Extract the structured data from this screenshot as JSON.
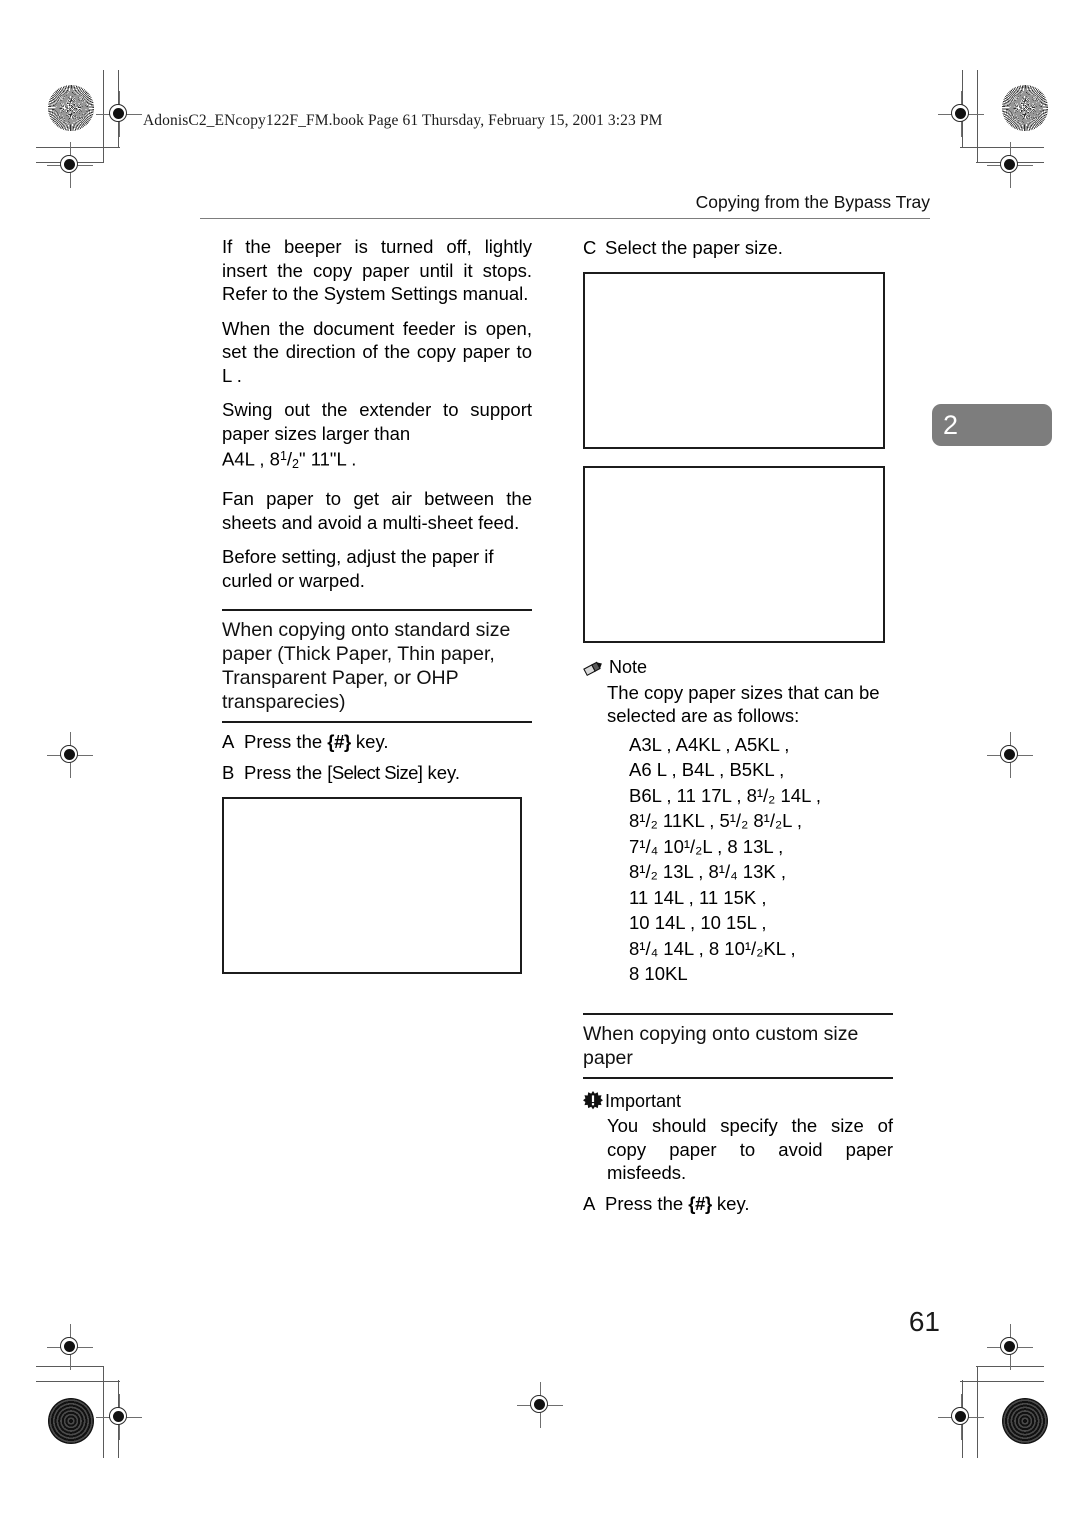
{
  "page": {
    "slugline": "AdonisC2_ENcopy122F_FM.book  Page 61  Thursday, February 15, 2001  3:23 PM",
    "running_header": "Copying from the Bypass Tray",
    "chapter_tab": "2",
    "folio": "61",
    "accent_gray": "#7d7d7d",
    "rule_black": "#1a1a1a"
  },
  "left_column": {
    "paragraphs": [
      "If the beeper is turned off, lightly insert the copy paper until it stops. Refer to the System Settings manual.",
      "When the document feeder is open, set the direction of the copy paper to L .",
      "Swing out the extender to support paper sizes larger than",
      "Fan paper to get air between the sheets and avoid a multi-sheet feed.",
      "Before setting, adjust the paper if curled or warped."
    ],
    "extender_sizes": "A4L , 8",
    "extender_sizes_tail": "\"  11\"L .",
    "section_heading": "When copying onto standard size paper (Thick Paper, Thin paper, Transparent Paper, or OHP transparecies)",
    "steps": [
      {
        "marker": "A",
        "pre": "Press the ",
        "key": "{#}",
        "post": " key."
      },
      {
        "marker": "B",
        "pre": "Press the ",
        "key": "[Select Size]",
        "post": " key."
      }
    ],
    "figure_caption": ""
  },
  "right_column": {
    "step_c": {
      "marker": "C",
      "text": "Select the paper size."
    },
    "note": {
      "icon": "pencil-icon",
      "label": "Note",
      "body": "The copy paper sizes that can be selected are as follows:"
    },
    "paper_sizes": [
      "A3L ,  A4KL  ,  A5KL  ,",
      "A6 L , B4L , B5KL  ,",
      "B6L , 11 17L , 8¹/₂ 14L ,",
      "8¹/₂ 11KL  , 5¹/₂ 8¹/₂L ,",
      "7¹/₄ 10¹/₂L , 8 13L ,",
      "8¹/₂ 13L , 8¹/₄ 13K ,",
      "11 14L , 11 15K ,",
      "10 14L , 10 15L ,",
      "8¹/₄ 14L , 8 10¹/₂KL  ,",
      "8 10KL"
    ],
    "section_heading": "When copying onto custom size paper",
    "important": {
      "icon": "exclamation-burst-icon",
      "label": "Important",
      "body": "You should specify the size of copy paper to avoid paper misfeeds."
    },
    "step_a": {
      "marker": "A",
      "pre": "Press the ",
      "key": "{#}",
      "post": " key."
    }
  }
}
